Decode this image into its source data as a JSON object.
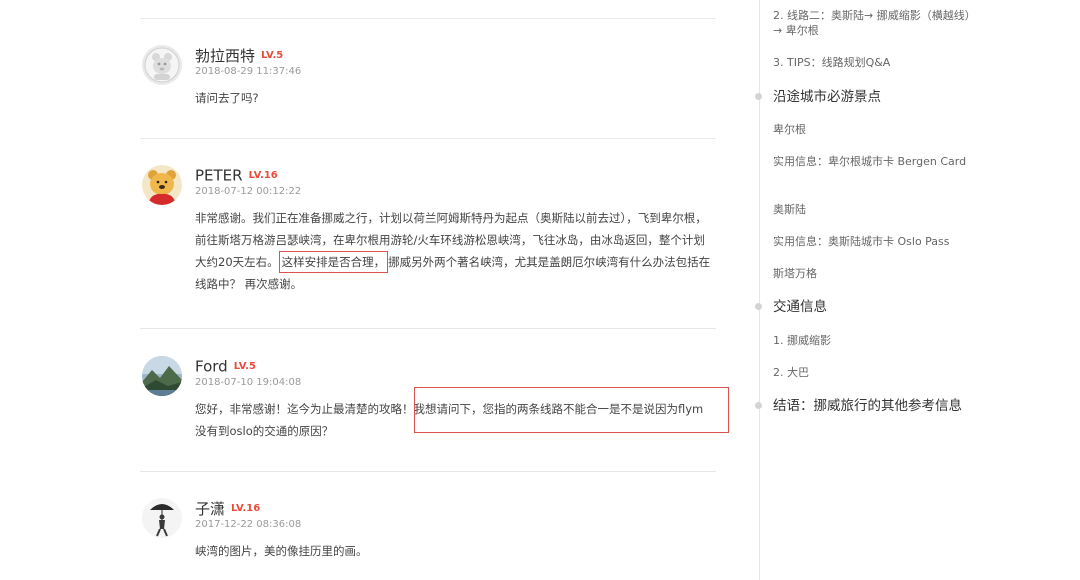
{
  "comments": [
    {
      "author": "勃拉西特",
      "level": "LV.5",
      "date": "2018-08-29 11:37:46",
      "content": "请问去了吗?"
    },
    {
      "author": "PETER",
      "level": "LV.16",
      "date": "2018-07-12 00:12:22",
      "content_before": "非常感谢。我们正在准备挪威之行，计划以荷兰阿姆斯特丹为起点（奥斯陆以前去过），飞到卑尔根，前往斯塔万格游吕瑟峡湾，在卑尔根用游轮/火车环线游松恩峡湾，飞往冰岛，由冰岛返回，整个计划大约20天左右。",
      "content_highlight": "这样安排是否合理，",
      "content_after": "挪威另外两个著名峡湾，尤其是盖朗厄尔峡湾有什么办法包括在线路中？ 再次感谢。"
    },
    {
      "author": "Ford",
      "level": "LV.5",
      "date": "2018-07-10 19:04:08",
      "content": "您好，非常感谢！迄今为止最清楚的攻略！我想请问下，您指的两条线路不能合一是不是说因为flym没有到oslo的交通的原因？"
    },
    {
      "author": "子潇",
      "level": "LV.16",
      "date": "2017-12-22 08:36:08",
      "content": "峡湾的图片，美的像挂历里的画。"
    }
  ],
  "toc": [
    {
      "label": "2. 线路二：奥斯陆→ 挪威缩影（横越线）→ 卑尔根",
      "major": false
    },
    {
      "label": "3. TIPS：线路规划Q&A",
      "major": false
    },
    {
      "label": "沿途城市必游景点",
      "major": true
    },
    {
      "label": "卑尔根",
      "major": false
    },
    {
      "label": "实用信息：卑尔根城市卡 Bergen Card",
      "major": false
    },
    {
      "label": "奥斯陆",
      "major": false
    },
    {
      "label": "实用信息：奥斯陆城市卡 Oslo Pass",
      "major": false
    },
    {
      "label": "斯塔万格",
      "major": false
    },
    {
      "label": "交通信息",
      "major": true
    },
    {
      "label": "1. 挪威缩影",
      "major": false
    },
    {
      "label": "2. 大巴",
      "major": false
    },
    {
      "label": "结语：挪威旅行的其他参考信息",
      "major": true
    }
  ],
  "colors": {
    "level_badge": "#e84c3d",
    "highlight_box": "#d9534f",
    "divider": "#e8e8e8"
  },
  "icons": [
    "avatar-default",
    "avatar-pooh",
    "avatar-landscape",
    "avatar-umbrella"
  ]
}
